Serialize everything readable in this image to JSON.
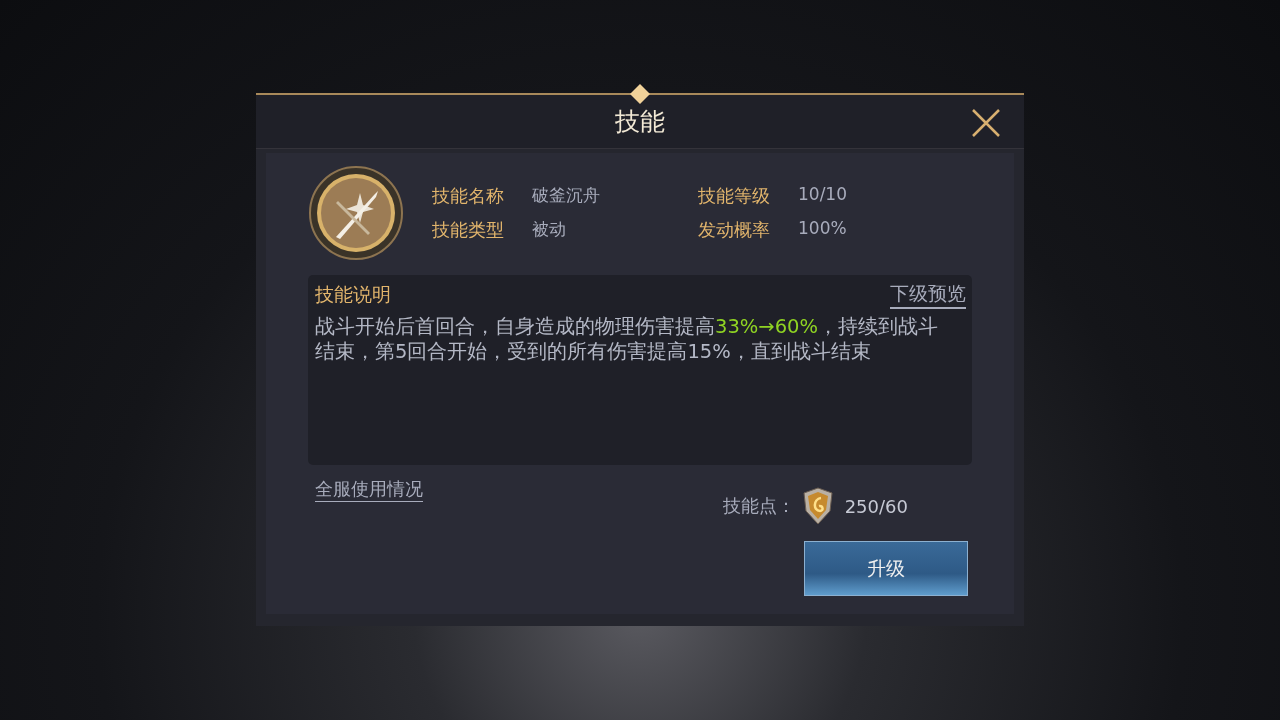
{
  "dialog": {
    "title": "技能"
  },
  "skill": {
    "fields": [
      {
        "label": "技能名称",
        "value": "破釜沉舟"
      },
      {
        "label": "技能等级",
        "value": "10/10"
      },
      {
        "label": "技能类型",
        "value": "被动"
      },
      {
        "label": "发动概率",
        "value": "100%"
      }
    ]
  },
  "description": {
    "title": "技能说明",
    "link": "下级预览",
    "segments": [
      {
        "text": "战斗开始后首回合，自身造成的物理伤害提高",
        "highlight": false
      },
      {
        "text": "33%→60%",
        "highlight": true
      },
      {
        "text": "，持续到战斗结束，第5回合开始，受到的所有伤害提高15%，直到战斗结束",
        "highlight": false
      }
    ]
  },
  "usage_link": "全服使用情况",
  "skill_points": {
    "label": "技能点：",
    "value": "250/60"
  },
  "upgrade_button": "升级"
}
